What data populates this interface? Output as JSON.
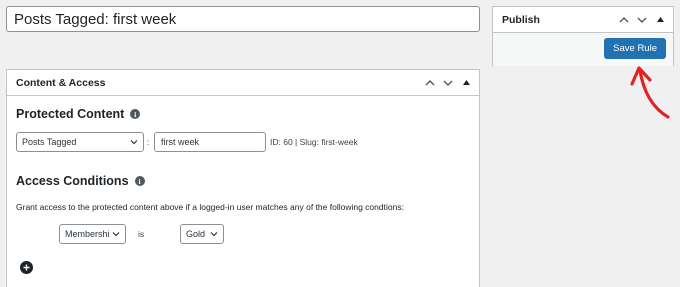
{
  "title_field": {
    "value": "Posts Tagged: first week"
  },
  "publish_box": {
    "title": "Publish",
    "save_label": "Save Rule"
  },
  "content_box": {
    "title": "Content & Access",
    "protected_content": {
      "heading": "Protected Content",
      "type_select": "Posts Tagged",
      "separator": ":",
      "tag_value": "first week",
      "meta": "ID: 60 | Slug: first-week"
    },
    "access_conditions": {
      "heading": "Access Conditions",
      "description": "Grant access to the protected content above if a logged-in user matches any of the following condtions:",
      "condition_select": "Membershi",
      "operator": "is",
      "value_select": "Gold"
    }
  },
  "colors": {
    "primary_button": "#2271b1",
    "annotation_arrow": "#e02424"
  },
  "icons": [
    "chevron-up-icon",
    "chevron-down-icon",
    "toggle-arrow-icon",
    "info-icon",
    "plus-circle-icon",
    "red-arrow-annotation"
  ]
}
